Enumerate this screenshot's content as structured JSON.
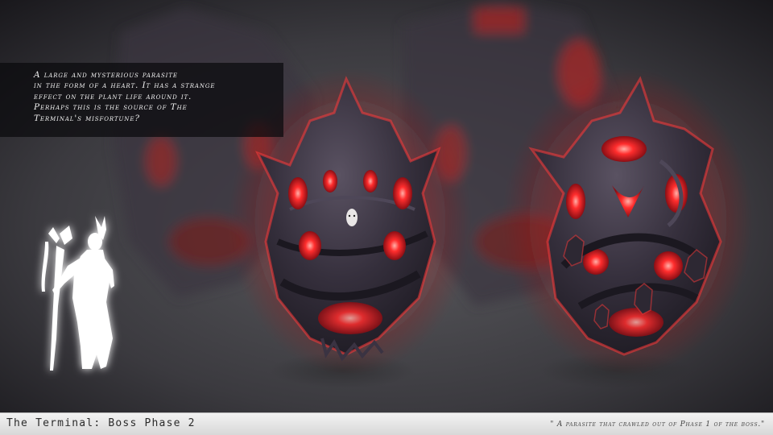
{
  "caption": {
    "text": "A large and mysterious parasite\nin the form of a heart. It has a strange\neffect on the plant life around it.\nPerhaps this is the source of The\nTerminal's misfortune?"
  },
  "footer": {
    "title": "The Terminal: Boss Phase 2",
    "quote": "\" A parasite that crawled out of Phase 1 of the boss.\""
  },
  "colors": {
    "glow_red": "#ff2a2a",
    "body_dark": "#2b2733",
    "body_mid": "#4a4452",
    "silhouette": "#ffffff",
    "footer_bg": "#e6e6e6"
  }
}
